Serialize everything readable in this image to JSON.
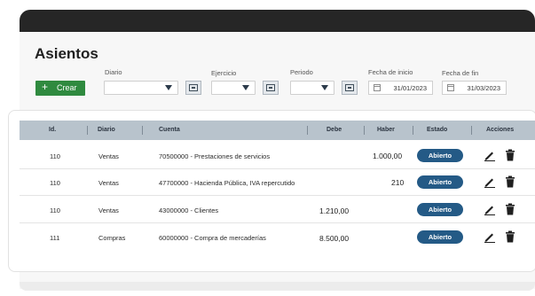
{
  "page": {
    "title": "Asientos"
  },
  "filters": {
    "create_label": "Crear",
    "diario_label": "Diario",
    "ejercicio_label": "Ejercicio",
    "periodo_label": "Periodo",
    "fecha_inicio_label": "Fecha de inicio",
    "fecha_inicio_value": "31/01/2023",
    "fecha_fin_label": "Fecha de fin",
    "fecha_fin_value": "31/03/2023"
  },
  "table": {
    "headers": [
      "Id.",
      "Diario",
      "Cuenta",
      "Debe",
      "Haber",
      "Estado",
      "Acciones"
    ],
    "rows": [
      {
        "id": "110",
        "diario": "Ventas",
        "cuenta": "70500000 - Prestaciones de servicios",
        "debe": "",
        "haber": "1.000,00",
        "estado": "Abierto"
      },
      {
        "id": "110",
        "diario": "Ventas",
        "cuenta": "47700000 - Hacienda Pública, IVA repercutido",
        "debe": "",
        "haber": "210",
        "estado": "Abierto"
      },
      {
        "id": "110",
        "diario": "Ventas",
        "cuenta": "43000000 - Clientes",
        "debe": "1.210,00",
        "haber": "",
        "estado": "Abierto"
      },
      {
        "id": "111",
        "diario": "Compras",
        "cuenta": "60000000 - Compra de mercaderías",
        "debe": "8.500,00",
        "haber": "",
        "estado": "Abierto"
      }
    ]
  },
  "colors": {
    "accent_green": "#2f8a3f",
    "badge_blue": "#245a86",
    "header_gray": "#b8c3cc"
  }
}
